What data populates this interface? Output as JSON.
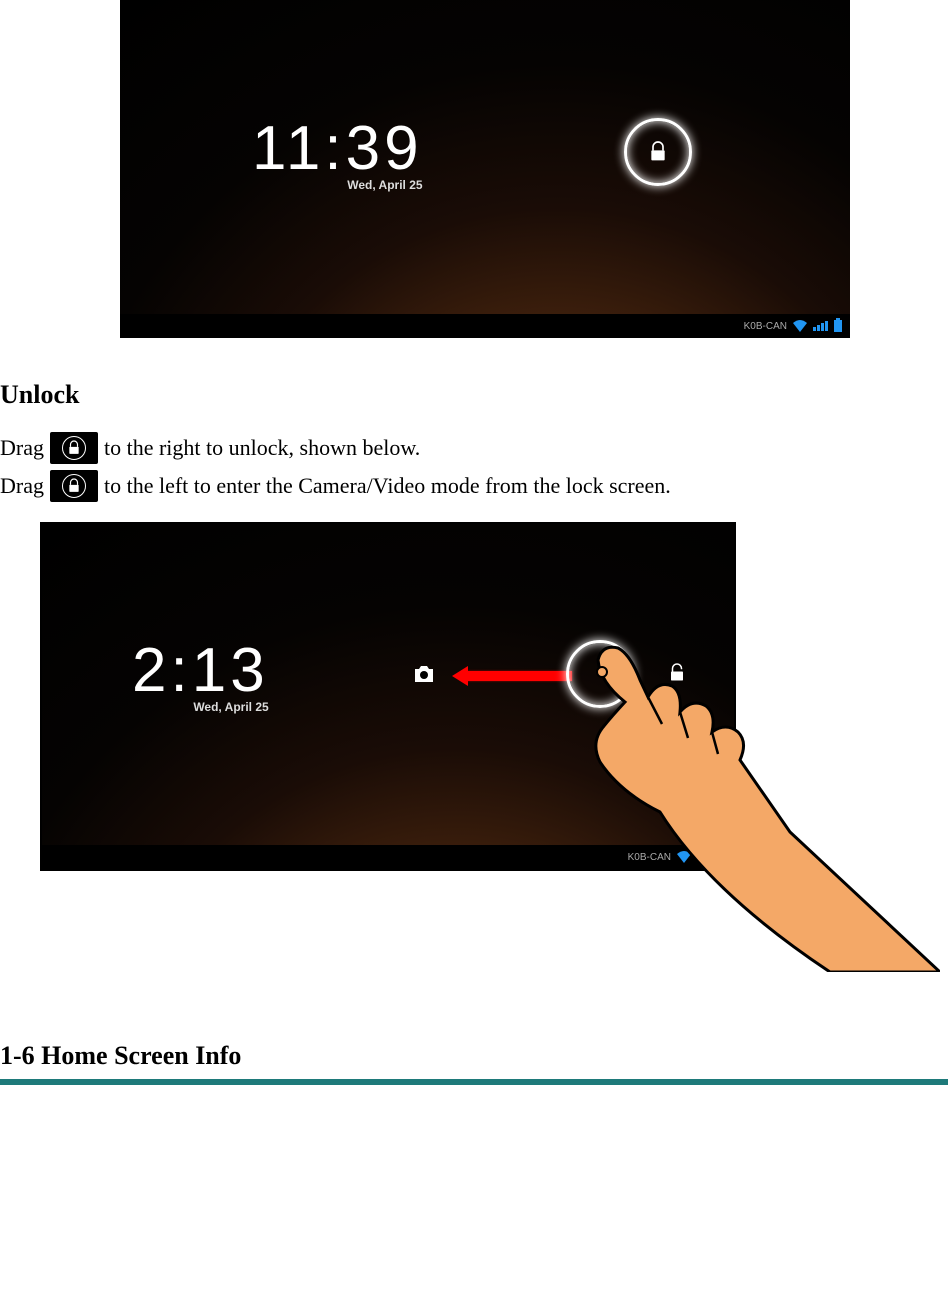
{
  "screenshot1": {
    "time": "11:39",
    "date": "Wed, April 25",
    "status_label": "K0B-CAN"
  },
  "section": {
    "unlock_heading": "Unlock",
    "line1_pre": "Drag",
    "line1_post": "to the right to unlock, shown below.",
    "line2_pre": "Drag",
    "line2_post": "to the left to enter the Camera/Video mode from the lock screen."
  },
  "screenshot2": {
    "time": "2:13",
    "date": "Wed, April 25",
    "status_label": "K0B-CAN"
  },
  "subsection": {
    "heading": "1-6 Home Screen Info"
  }
}
